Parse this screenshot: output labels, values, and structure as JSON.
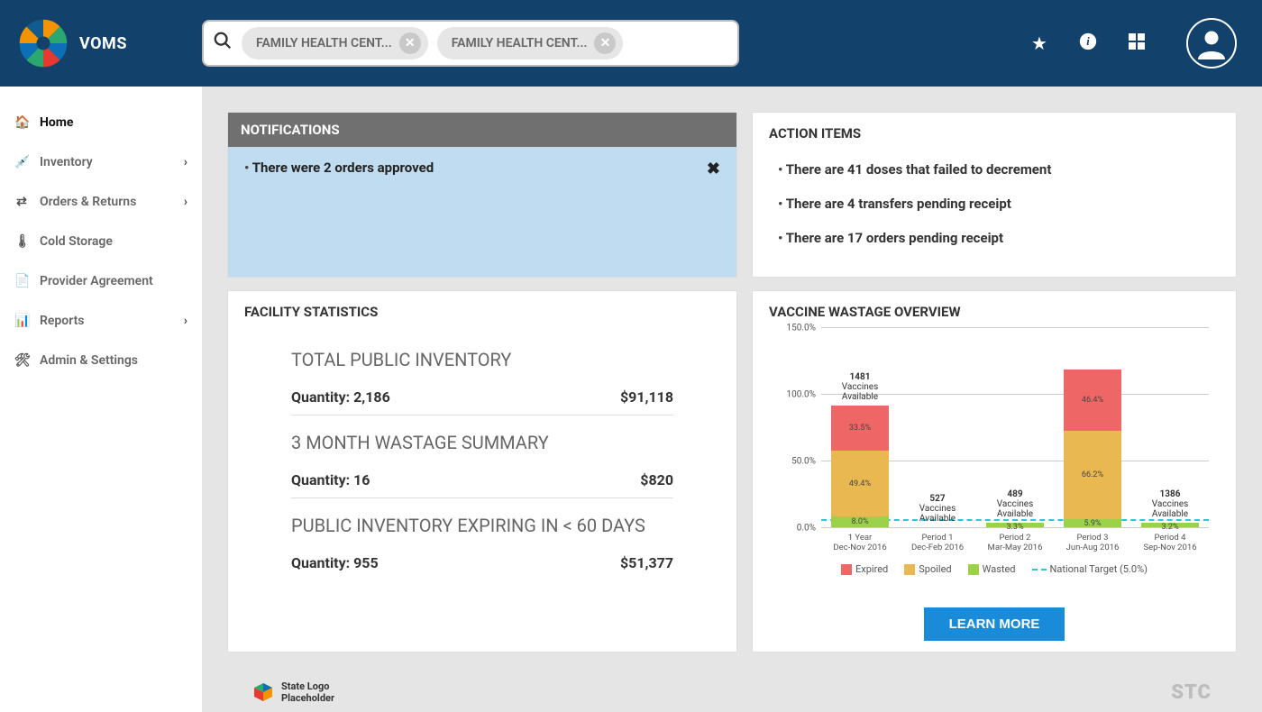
{
  "header": {
    "app_name": "VOMS",
    "chips": [
      "FAMILY HEALTH CENT...",
      "FAMILY HEALTH CENT..."
    ]
  },
  "sidebar": {
    "items": [
      {
        "label": "Home",
        "has_sub": false,
        "active": true
      },
      {
        "label": "Inventory",
        "has_sub": true,
        "active": false
      },
      {
        "label": "Orders & Returns",
        "has_sub": true,
        "active": false
      },
      {
        "label": "Cold Storage",
        "has_sub": false,
        "active": false
      },
      {
        "label": "Provider Agreement",
        "has_sub": false,
        "active": false
      },
      {
        "label": "Reports",
        "has_sub": true,
        "active": false
      },
      {
        "label": "Admin & Settings",
        "has_sub": false,
        "active": false
      }
    ]
  },
  "notifications": {
    "title": "NOTIFICATIONS",
    "entries": [
      "There were 2 orders approved"
    ]
  },
  "action_items": {
    "title": "ACTION ITEMS",
    "entries": [
      "There are 41 doses that failed to decrement",
      "There are 4 transfers pending receipt",
      "There are 17 orders pending receipt"
    ]
  },
  "facility_stats": {
    "title": "FACILITY STATISTICS",
    "blocks": [
      {
        "heading": "TOTAL PUBLIC INVENTORY",
        "qty_label": "Quantity: 2,186",
        "value": "$91,118"
      },
      {
        "heading": "3 MONTH WASTAGE SUMMARY",
        "qty_label": "Quantity: 16",
        "value": "$820"
      },
      {
        "heading": "PUBLIC INVENTORY EXPIRING IN < 60 DAYS",
        "qty_label": "Quantity: 955",
        "value": "$51,377"
      }
    ]
  },
  "wastage": {
    "title": "VACCINE WASTAGE OVERVIEW",
    "learn_more": "LEARN MORE"
  },
  "footer": {
    "left_line1": "State Logo",
    "left_line2": "Placeholder",
    "right": "STC"
  },
  "chart_data": {
    "type": "bar",
    "y_ticks": [
      "0.0%",
      "50.0%",
      "100.0%",
      "150.0%"
    ],
    "ylim_pct": 150,
    "national_target_pct": 5.0,
    "legend": {
      "expired": "Expired",
      "spoiled": "Spoiled",
      "wasted": "Wasted",
      "target": "National Target (5.0%)"
    },
    "categories": [
      {
        "line1": "1 Year",
        "line2": "Dec-Nov 2016",
        "vaccines_available": 1481,
        "expired": 33.5,
        "spoiled": 49.4,
        "wasted": 8.0
      },
      {
        "line1": "Period 1",
        "line2": "Dec-Feb 2016",
        "vaccines_available": 527,
        "expired": 0.0,
        "spoiled": 0.0,
        "wasted": 0.0
      },
      {
        "line1": "Period 2",
        "line2": "Mar-May 2016",
        "vaccines_available": 489,
        "expired": 0.0,
        "spoiled": 0.0,
        "wasted": 3.3
      },
      {
        "line1": "Period 3",
        "line2": "Jun-Aug 2016",
        "vaccines_available": null,
        "expired": 46.4,
        "spoiled": 66.2,
        "wasted": 5.9
      },
      {
        "line1": "Period 4",
        "line2": "Sep-Nov 2016",
        "vaccines_available": 1386,
        "expired": 0.0,
        "spoiled": 0.0,
        "wasted": 3.2
      }
    ]
  }
}
